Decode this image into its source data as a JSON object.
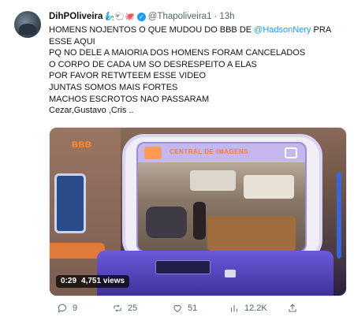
{
  "tweet": {
    "author_name": "DihPOliveira",
    "author_emojis": "🧞‍♂️🐑🐙",
    "verified_symbol": "✓",
    "handle": "@Thapoliveira1",
    "separator": "·",
    "time": "13h",
    "text": {
      "line1_pre": "HOMENS NOJENTOS O QUE MUDOU DO BBB DE ",
      "line1_mention": "@HadsonNery",
      "line1_post": " PRA",
      "line2": "ESSE AQUI",
      "line3": "PQ NO DELE A MAIORIA DOS HOMENS FORAM CANCELADOS",
      "line4": "O CORPO DE CADA UM SO DESRESPEITO A ELAS",
      "line5": "POR FAVOR RETWTEEM ESSE VIDEO",
      "line6": "JUNTAS SOMOS MAIS FORTES",
      "line7": "MACHOS ESCROTOS NAO PASSARAM",
      "line8": "Cezar,Gustavo ,Cris .."
    }
  },
  "media": {
    "bbb_logo": "BBB",
    "screen_title": "CENTRAL DE IMAGENS",
    "duration": "0:29",
    "views": "4,751 views"
  },
  "actions": {
    "replies": "9",
    "retweets": "25",
    "likes": "51",
    "views": "12.2K"
  }
}
